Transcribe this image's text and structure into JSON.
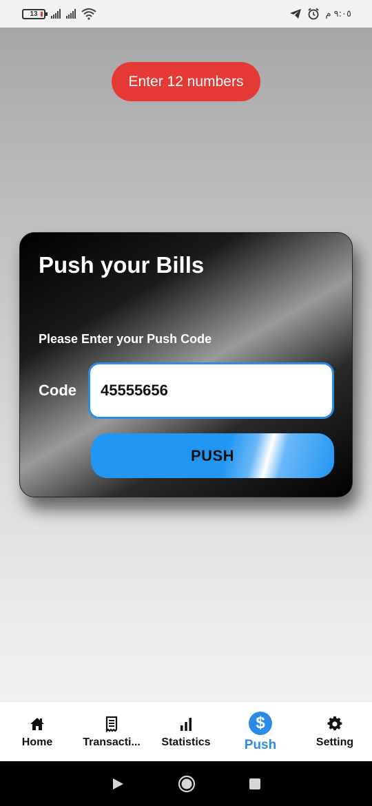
{
  "status_bar": {
    "battery_level": "13",
    "time": "٩:٠٥ م",
    "icons": [
      "battery-icon",
      "signal-icon",
      "signal-icon",
      "wifi-icon",
      "telegram-icon",
      "alarm-icon"
    ]
  },
  "toast": {
    "message": "Enter 12 numbers",
    "color": "#e53935"
  },
  "card": {
    "title": "Push your Bills",
    "subtitle": "Please Enter your Push Code",
    "code_label": "Code",
    "code_value": "45555656",
    "push_label": "PUSH",
    "accent": "#2196f3"
  },
  "bottom_nav": {
    "items": [
      {
        "label": "Home",
        "icon": "home-icon",
        "active": false
      },
      {
        "label": "Transacti...",
        "icon": "receipt-icon",
        "active": false
      },
      {
        "label": "Statistics",
        "icon": "bar-chart-icon",
        "active": false
      },
      {
        "label": "Push",
        "icon": "dollar-icon",
        "active": true
      },
      {
        "label": "Setting",
        "icon": "gear-icon",
        "active": false
      }
    ],
    "active_color": "#2c8be8"
  },
  "system_nav": {
    "icons": [
      "back-icon",
      "home-circle-icon",
      "recents-icon"
    ]
  }
}
